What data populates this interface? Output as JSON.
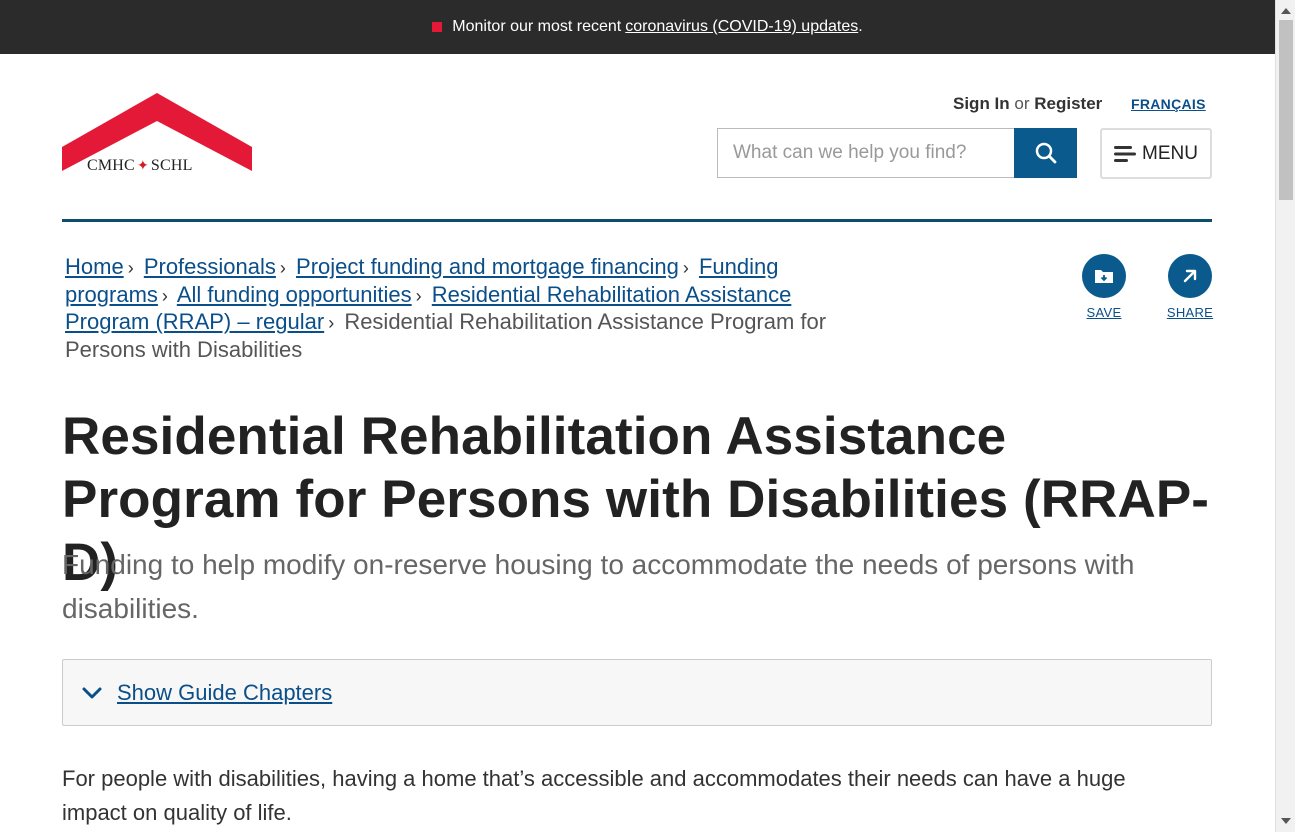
{
  "alert": {
    "prefix": "Monitor our most recent",
    "link": "coronavirus (COVID-19) updates",
    "suffix": "."
  },
  "logo": {
    "left": "CMHC",
    "right": "SCHL",
    "brand_color": "#e31937"
  },
  "header": {
    "sign_in": "Sign In",
    "or": "or",
    "register": "Register",
    "language": "FRANÇAIS",
    "search_placeholder": "What can we help you find?",
    "menu_label": "MENU"
  },
  "breadcrumb": {
    "items": [
      "Home",
      "Professionals",
      "Project funding and mortgage financing",
      "Funding programs",
      "All funding opportunities",
      "Residential Rehabilitation Assistance Program (RRAP) – regular"
    ],
    "current": "Residential Rehabilitation Assistance Program for Persons with Disabilities"
  },
  "actions": {
    "save": "SAVE",
    "share": "SHARE"
  },
  "page": {
    "title": "Residential Rehabilitation Assistance Program for Persons with Disabilities (RRAP-D)",
    "subtitle": "Funding to help modify on-reserve housing to accommodate the needs of persons with disabilities.",
    "guide_toggle": "Show Guide Chapters",
    "intro": "For people with disabilities, having a home that’s accessible and accommodates their needs can have a huge impact on quality of life."
  },
  "colors": {
    "primary": "#0b5a8d",
    "link": "#0b4f8a",
    "alert_bg": "#2b2b2b"
  }
}
